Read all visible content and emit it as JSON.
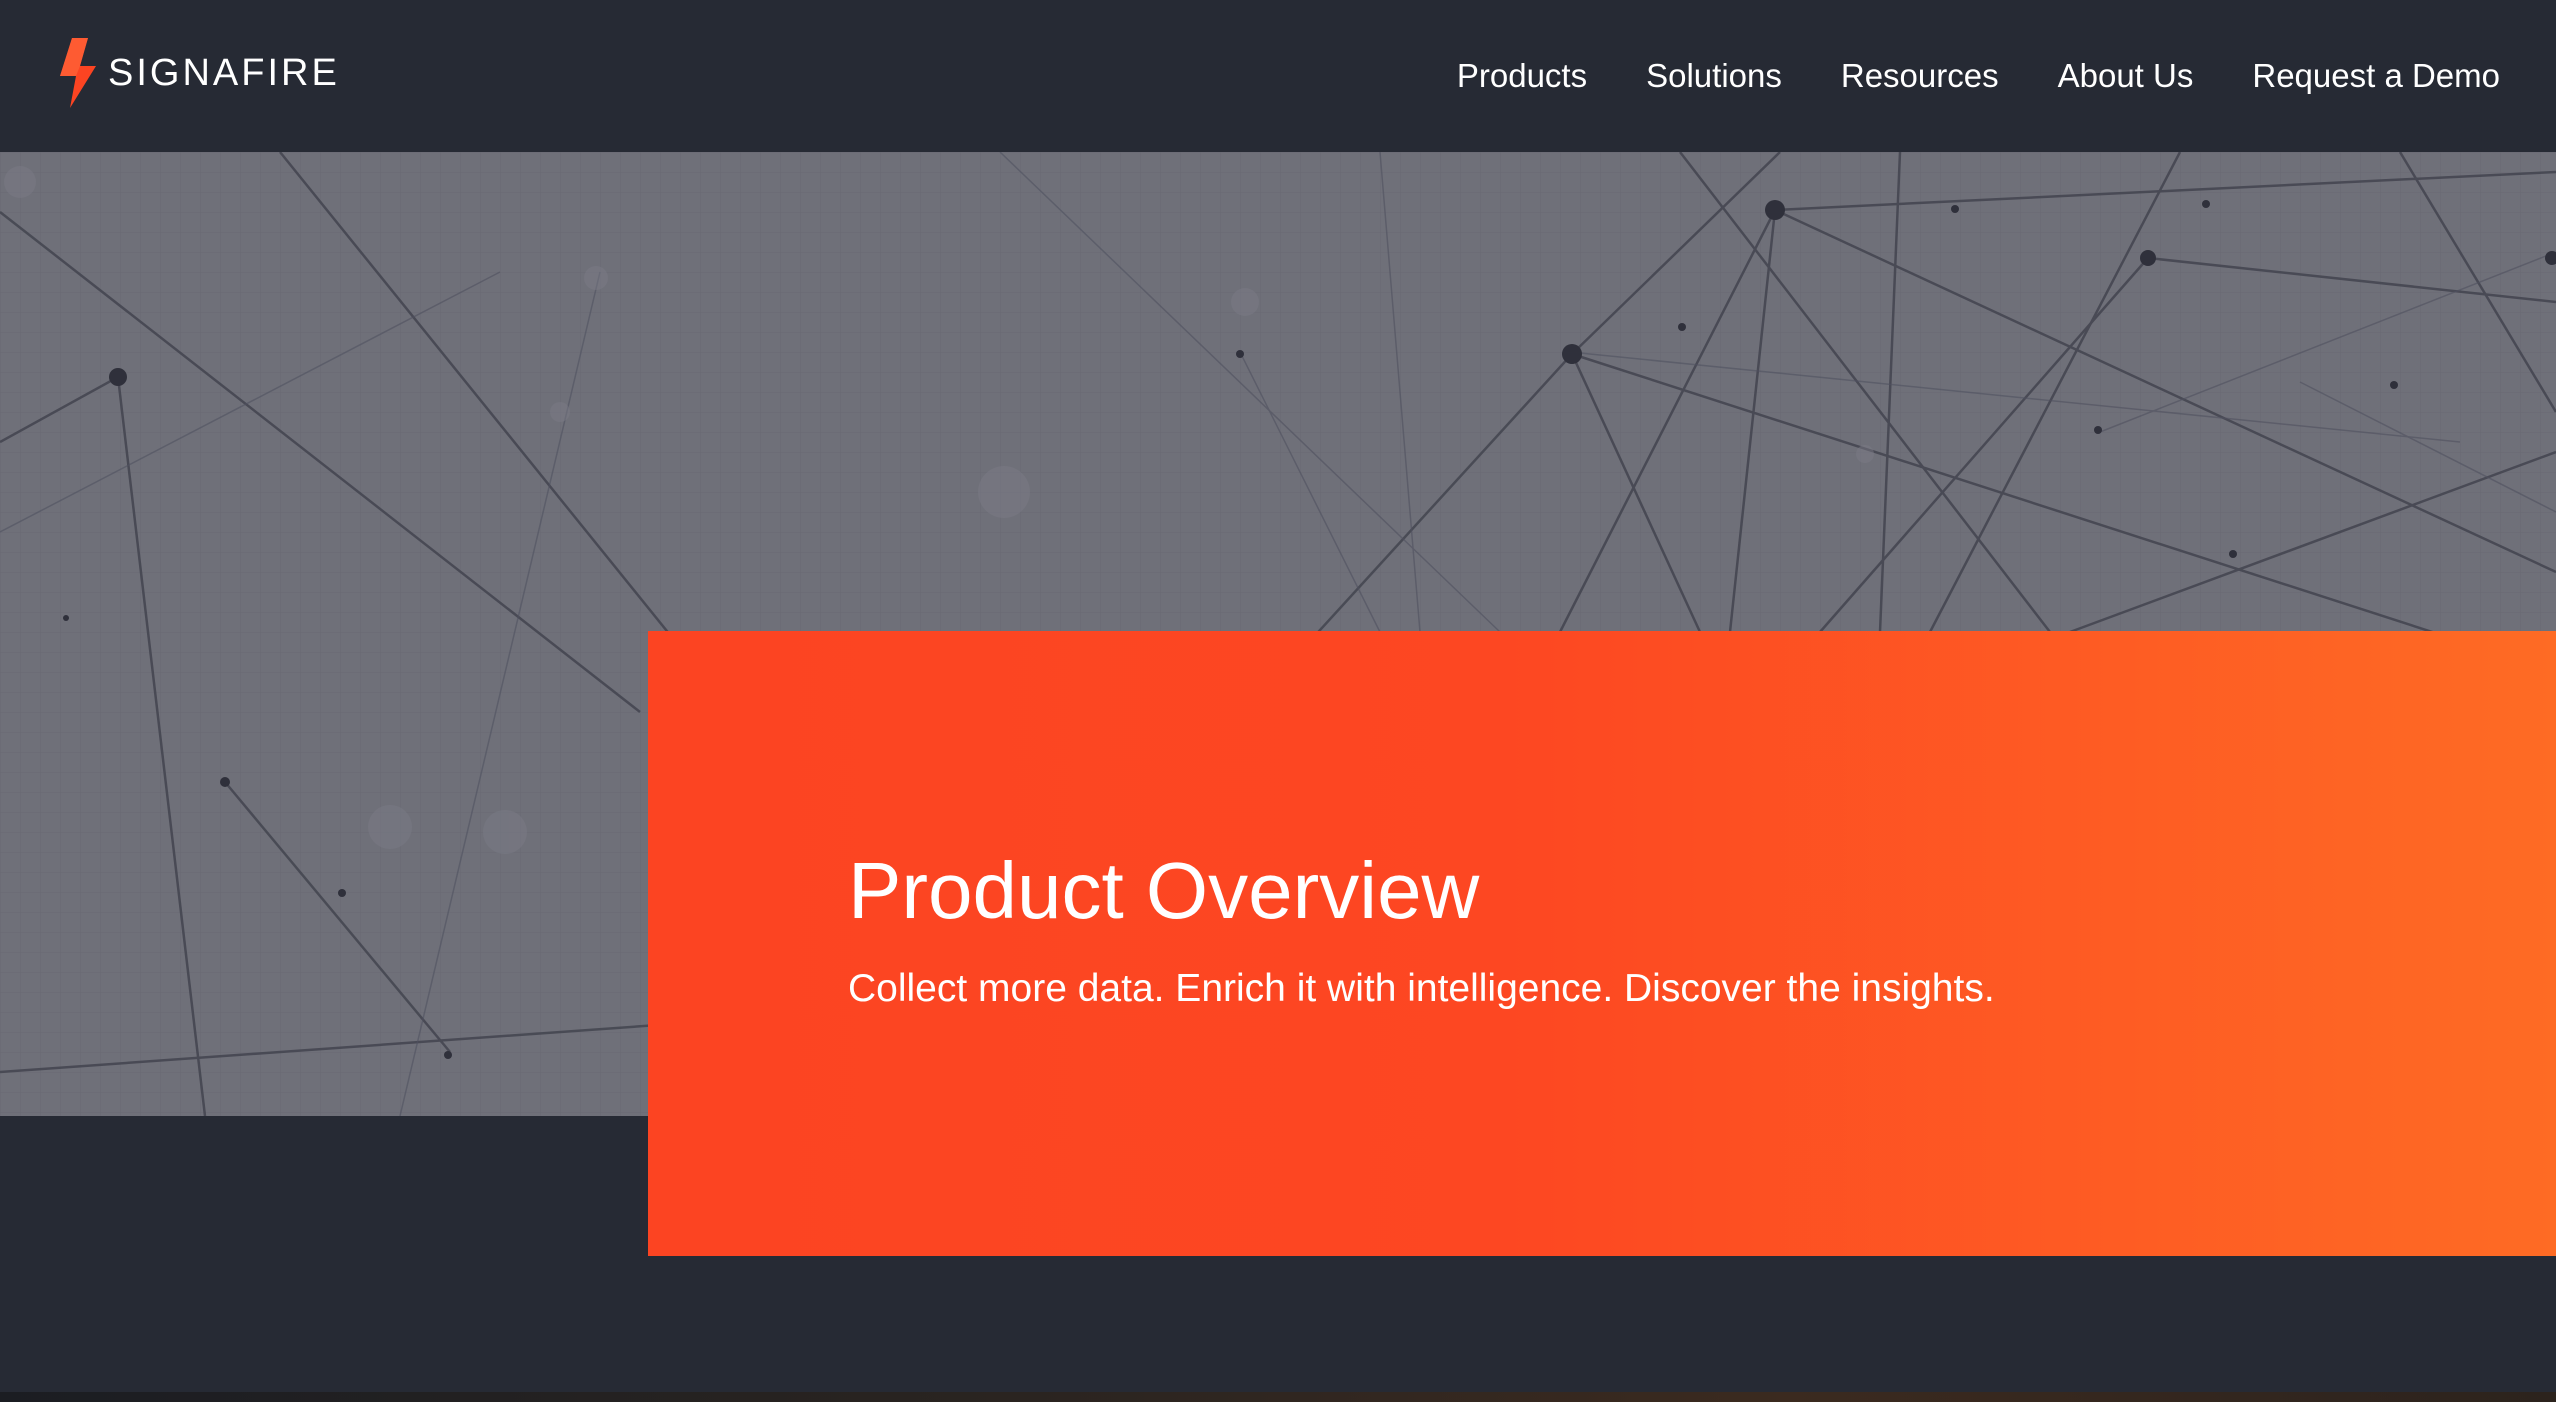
{
  "brand": {
    "name": "SIGNAFIRE",
    "logo_icon": "lightning-bolt-icon",
    "accent_color": "#fc4422"
  },
  "nav": {
    "items": [
      {
        "label": "Products"
      },
      {
        "label": "Solutions"
      },
      {
        "label": "Resources"
      },
      {
        "label": "About Us"
      },
      {
        "label": "Request a Demo"
      }
    ]
  },
  "hero": {
    "title": "Product Overview",
    "subtitle": "Collect more data. Enrich it with intelligence. Discover the insights."
  },
  "colors": {
    "header_bg": "#262a34",
    "hero_bg": "#6f7079",
    "panel_start": "#fc4422",
    "panel_end": "#fe6b24",
    "text": "#ffffff"
  }
}
